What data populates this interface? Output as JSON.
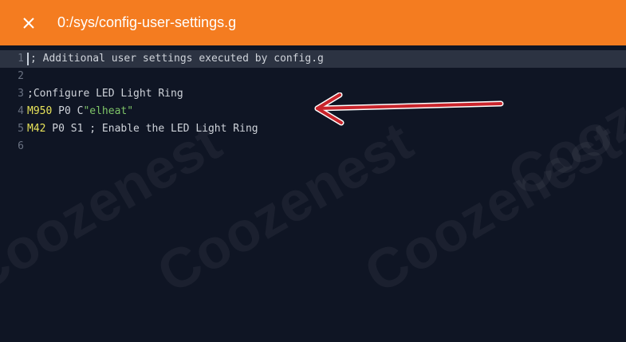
{
  "header": {
    "title": "0:/sys/config-user-settings.g",
    "close_icon": "close-icon",
    "bg_color": "#f47c20"
  },
  "editor": {
    "bg_color": "#0f1524",
    "lines": [
      {
        "num": "1",
        "segments": [
          {
            "t": "; Additional user settings executed by config.g",
            "c": "code"
          }
        ]
      },
      {
        "num": "2",
        "segments": []
      },
      {
        "num": "3",
        "segments": [
          {
            "t": ";Configure LED Light Ring",
            "c": "code"
          }
        ]
      },
      {
        "num": "4",
        "segments": [
          {
            "t": "M950",
            "c": "kw"
          },
          {
            "t": " P0 C",
            "c": "code"
          },
          {
            "t": "\"elheat\"",
            "c": "str"
          }
        ]
      },
      {
        "num": "5",
        "segments": [
          {
            "t": "M42",
            "c": "kw"
          },
          {
            "t": " P0 S1 ; Enable the LED Light Ring",
            "c": "code"
          }
        ]
      },
      {
        "num": "6",
        "segments": []
      }
    ]
  },
  "annotation": {
    "arrow_color": "#c9242b"
  },
  "watermark": {
    "text": "Coozenest"
  }
}
